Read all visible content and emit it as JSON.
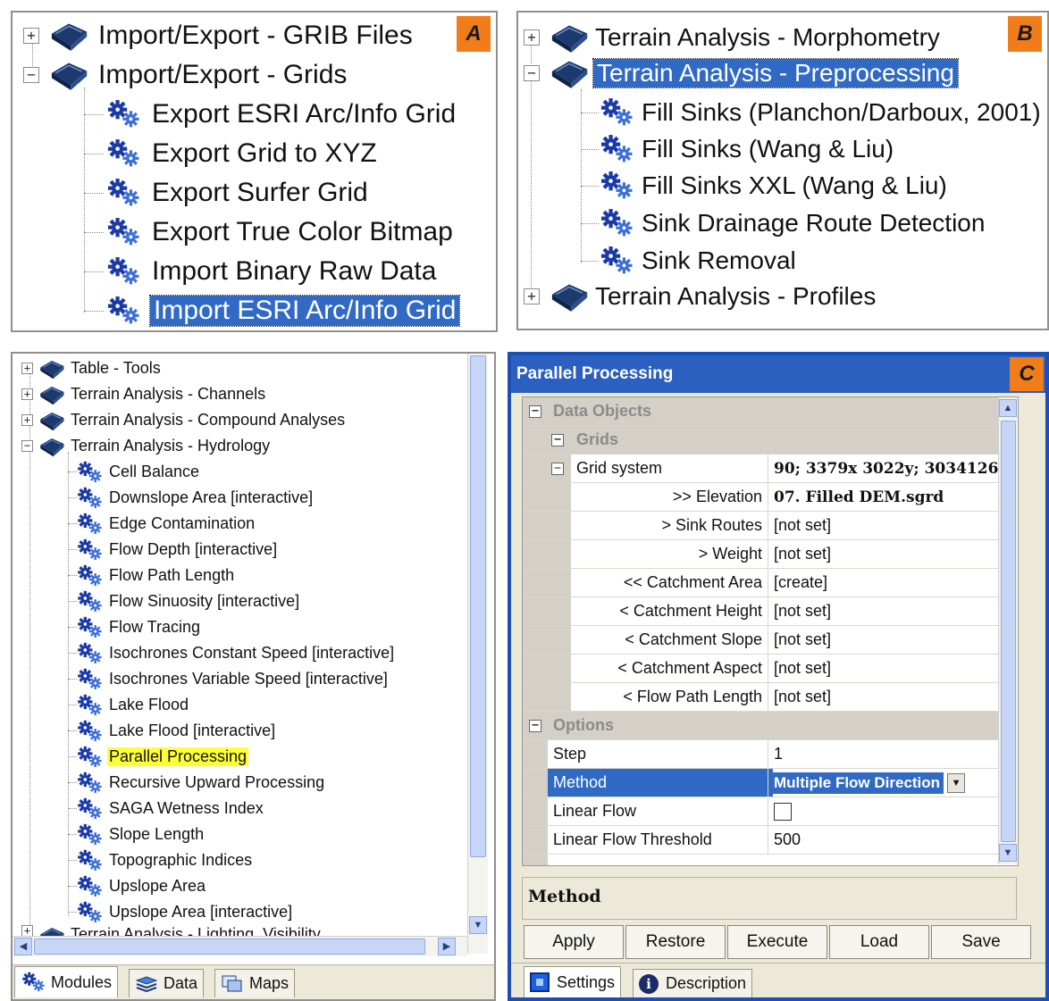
{
  "panelA": {
    "badge": "A",
    "items": [
      {
        "expander": "+",
        "label": "Import/Export - GRIB Files"
      },
      {
        "expander": "−",
        "label": "Import/Export - Grids"
      },
      {
        "label": "Export ESRI Arc/Info Grid"
      },
      {
        "label": "Export Grid to XYZ"
      },
      {
        "label": "Export Surfer Grid"
      },
      {
        "label": "Export True Color Bitmap"
      },
      {
        "label": "Import Binary Raw Data"
      },
      {
        "label": "Import ESRI Arc/Info Grid",
        "selected": true
      }
    ]
  },
  "panelB": {
    "badge": "B",
    "items": [
      {
        "expander": "+",
        "label": "Terrain Analysis - Morphometry"
      },
      {
        "expander": "−",
        "label": "Terrain Analysis - Preprocessing",
        "selected": true
      },
      {
        "label": "Fill Sinks (Planchon/Darboux, 2001)"
      },
      {
        "label": "Fill Sinks (Wang & Liu)"
      },
      {
        "label": "Fill Sinks XXL (Wang & Liu)"
      },
      {
        "label": "Sink Drainage Route Detection"
      },
      {
        "label": "Sink Removal"
      },
      {
        "expander": "+",
        "label": "Terrain Analysis - Profiles"
      }
    ]
  },
  "modules": {
    "groups": [
      {
        "expander": "+",
        "label": "Table - Tools"
      },
      {
        "expander": "+",
        "label": "Terrain Analysis - Channels"
      },
      {
        "expander": "+",
        "label": "Terrain Analysis - Compound Analyses"
      },
      {
        "expander": "−",
        "label": "Terrain Analysis - Hydrology"
      }
    ],
    "tools": [
      "Cell Balance",
      "Downslope Area [interactive]",
      "Edge Contamination",
      "Flow Depth [interactive]",
      "Flow Path Length",
      "Flow Sinuosity [interactive]",
      "Flow Tracing",
      "Isochrones Constant Speed [interactive]",
      "Isochrones Variable Speed [interactive]",
      "Lake Flood",
      "Lake Flood [interactive]",
      "Parallel Processing",
      "Recursive Upward Processing",
      "SAGA Wetness Index",
      "Slope Length",
      "Topographic Indices",
      "Upslope Area",
      "Upslope Area [interactive]"
    ],
    "highlighted_tool": "Parallel Processing",
    "last_group": {
      "expander": "+",
      "label": "Terrain Analysis - Lighting, Visibility"
    },
    "tabs": {
      "modules": "Modules",
      "data": "Data",
      "maps": "Maps"
    }
  },
  "panelC": {
    "badge": "C",
    "title": "Parallel Processing",
    "data_objects_label": "Data Objects",
    "grids_label": "Grids",
    "grid_system": {
      "name": "Grid system",
      "value": "90; 3379x 3022y; 3034126."
    },
    "params": [
      {
        "name": ">> Elevation",
        "value": "07. Filled DEM.sgrd",
        "bold": true
      },
      {
        "name": "> Sink Routes",
        "value": "[not set]"
      },
      {
        "name": "> Weight",
        "value": "[not set]"
      },
      {
        "name": "<< Catchment Area",
        "value": "[create]"
      },
      {
        "name": "< Catchment Height",
        "value": "[not set]"
      },
      {
        "name": "< Catchment Slope",
        "value": "[not set]"
      },
      {
        "name": "< Catchment Aspect",
        "value": "[not set]"
      },
      {
        "name": "< Flow Path Length",
        "value": "[not set]"
      }
    ],
    "options_label": "Options",
    "options": {
      "step": {
        "name": "Step",
        "value": "1"
      },
      "method": {
        "name": "Method",
        "value": "Multiple Flow Direction"
      },
      "linear_flow": {
        "name": "Linear Flow",
        "checked": false
      },
      "linear_threshold": {
        "name": "Linear Flow Threshold",
        "value": "500"
      }
    },
    "help_title": "Method",
    "buttons": {
      "apply": "Apply",
      "restore": "Restore",
      "execute": "Execute",
      "load": "Load",
      "save": "Save"
    },
    "tabs": {
      "settings": "Settings",
      "description": "Description"
    }
  },
  "colors": {
    "selection": "#316ac5",
    "highlight": "#ffff33",
    "badge": "#f07d1a",
    "title_bar": "#2b5fc0"
  },
  "icons": {
    "group": "book-icon",
    "tool": "gear-icon"
  }
}
